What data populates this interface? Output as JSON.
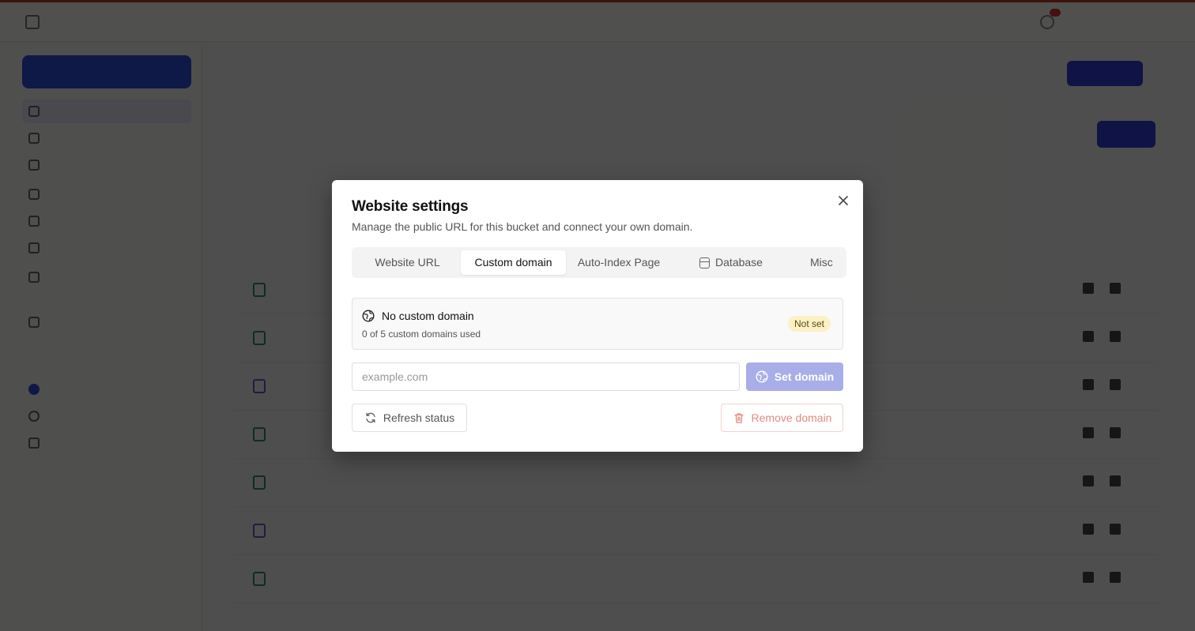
{
  "modal": {
    "title": "Website settings",
    "subtitle": "Manage the public URL for this bucket and connect your own domain.",
    "close_icon": "close-icon",
    "tabs": [
      {
        "label": "Website URL",
        "active": false
      },
      {
        "label": "Custom domain",
        "active": true
      },
      {
        "label": "Auto-Index Page",
        "active": false
      },
      {
        "label": "Database",
        "active": false,
        "icon": "database-icon"
      },
      {
        "label": "Misc",
        "active": false
      }
    ],
    "status": {
      "icon": "globe-icon",
      "title": "No custom domain",
      "subtitle": "0 of 5 custom domains used",
      "badge": "Not set"
    },
    "domain_input": {
      "placeholder": "example.com",
      "value": ""
    },
    "set_button": {
      "label": "Set domain",
      "icon": "globe-icon"
    },
    "refresh_button": {
      "label": "Refresh status",
      "icon": "refresh-icon"
    },
    "remove_button": {
      "label": "Remove domain",
      "icon": "trash-icon"
    }
  },
  "colors": {
    "accent": "#2f3bd8",
    "accent_disabled": "#a8aee8",
    "badge_bg": "#fcf0c6",
    "danger_text": "#e08b80"
  }
}
